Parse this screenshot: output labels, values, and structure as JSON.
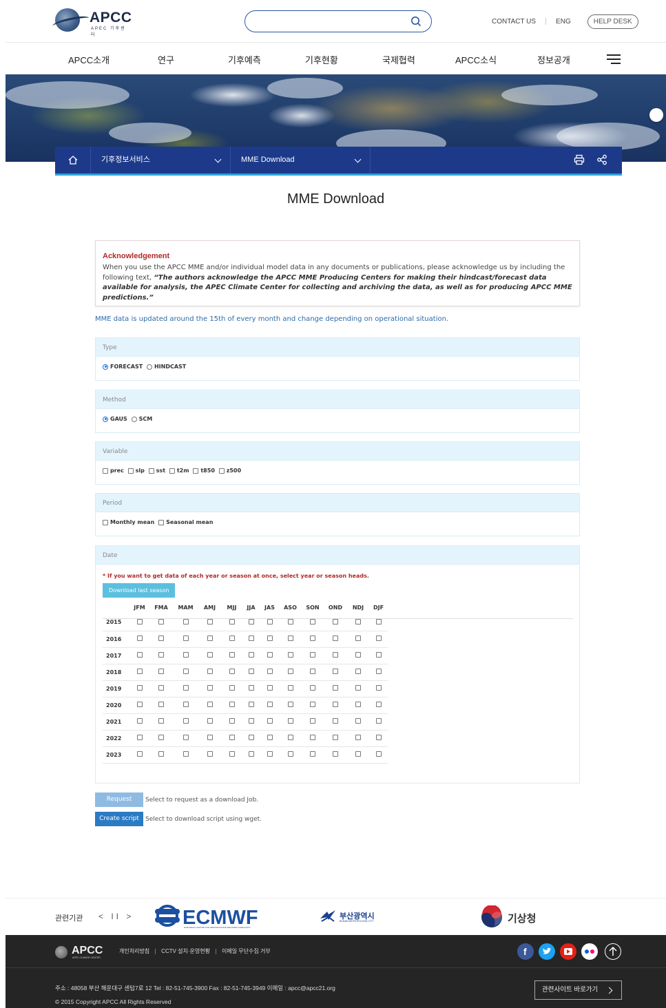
{
  "header": {
    "logo_text": "APCC",
    "logo_sub": "APEC 기후센터",
    "search_placeholder": "",
    "links": [
      "CONTACT US",
      "ENG"
    ],
    "helpdesk": "HELP DESK"
  },
  "nav": {
    "items": [
      "APCC소개",
      "연구",
      "기후예측",
      "기후현황",
      "국제협력",
      "APCC소식",
      "정보공개"
    ]
  },
  "breadcrumb": {
    "level1": "기후정보서비스",
    "level2": "MME Download"
  },
  "page_title": "MME Download",
  "acknowledgement": {
    "title": "Acknowledgement",
    "intro": "When you use the APCC MME and/or individual model data in any documents or publications, please acknowledge us by including the following text, ",
    "quote": "“The authors acknowledge the APCC MME Producing Centers for making their hindcast/forecast data available for analysis, the APEC Climate Center for collecting and archiving the data, as well as for producing APCC MME predictions.”"
  },
  "update_note": "MME data is updated around the 15th of every month and change depending on operational situation.",
  "form": {
    "type": {
      "label": "Type",
      "options": [
        {
          "label": "FORECAST",
          "selected": true
        },
        {
          "label": "HINDCAST",
          "selected": false
        }
      ]
    },
    "method": {
      "label": "Method",
      "options": [
        {
          "label": "GAUS",
          "selected": true
        },
        {
          "label": "SCM",
          "selected": false
        }
      ]
    },
    "variable": {
      "label": "Variable",
      "options": [
        "prec",
        "slp",
        "sst",
        "t2m",
        "t850",
        "z500"
      ]
    },
    "period": {
      "label": "Period",
      "options": [
        "Monthly mean",
        "Seasonal mean"
      ]
    },
    "date": {
      "label": "Date",
      "note": "* If you want to get data of each year or season at once, select year or season heads.",
      "download_last_label": "Download last season",
      "seasons": [
        "JFM",
        "FMA",
        "MAM",
        "AMJ",
        "MJJ",
        "JJA",
        "JAS",
        "ASO",
        "SON",
        "OND",
        "NDJ",
        "DJF"
      ],
      "years": [
        "2015",
        "2016",
        "2017",
        "2018",
        "2019",
        "2020",
        "2021",
        "2022",
        "2023"
      ]
    }
  },
  "actions": {
    "request_label": "Request",
    "request_desc": "Select to request as a download Job.",
    "script_label": "Create script",
    "script_desc": "Select to download script using wget."
  },
  "related": {
    "label": "관련기관",
    "controls": "< II >",
    "ecmwf": "ECMWF",
    "ecmwf_sub": "EUROPEAN CENTRE FOR MEDIUM-RANGE WEATHER FORECASTS",
    "busan": "부산광역시",
    "busan_sub": "BUSAN METROPOLITAN CITY",
    "kma": "기상청"
  },
  "footer": {
    "logo_text": "APCC",
    "logo_sub": "APEC CLIMATE CENTER",
    "links": [
      "개인처리방침",
      "CCTV 설치·운영현황",
      "이메일 무단수집 거부"
    ],
    "address": "주소 : 48058 부산 해운대구 센텀7로 12   Tel : 82-51-745-3900   Fax : 82-51-745-3949   이메일 : apcc@apcc21.org",
    "copyright": "© 2015 Copyright APCC All Rights Reserved",
    "related_sites": "관련사이트 바로가기"
  },
  "colors": {
    "nav_blue": "#1d3a8a",
    "accent_cyan": "#2ea3d8",
    "ack_red": "#b02a2a",
    "request_btn": "#8fbbe2",
    "script_btn": "#2b7ac4"
  }
}
